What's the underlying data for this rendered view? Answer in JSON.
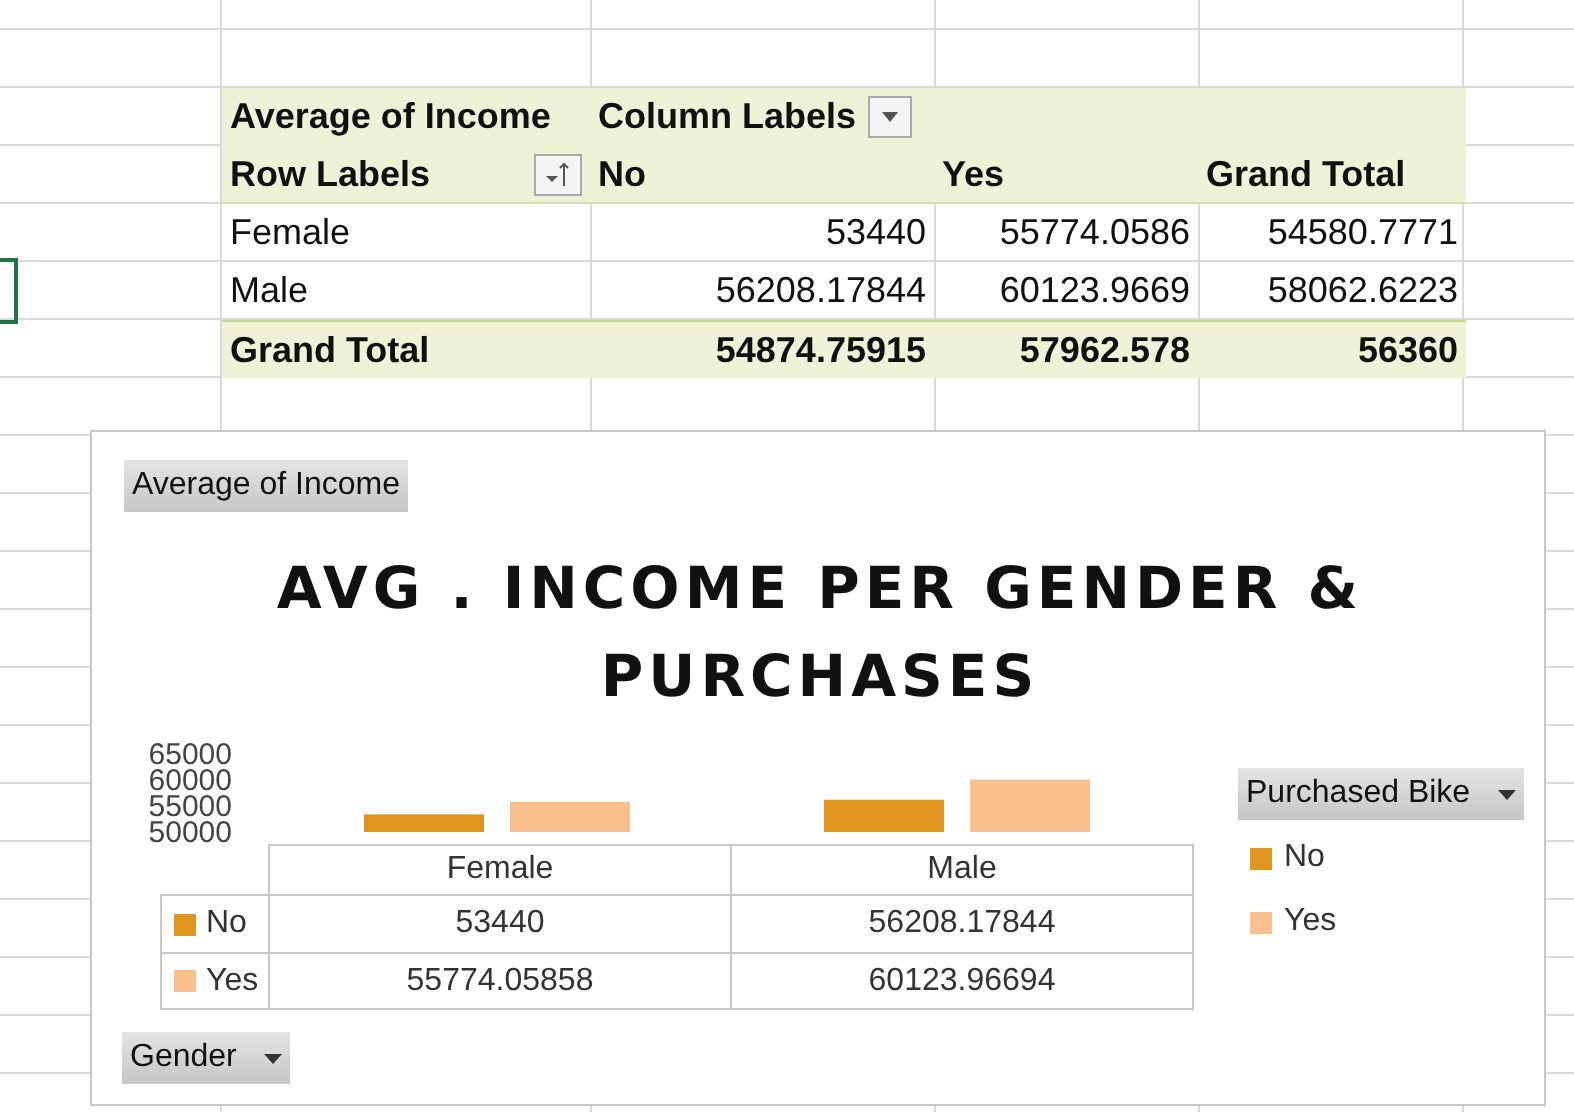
{
  "pivot": {
    "value_field": "Average of Income",
    "column_labels": "Column Labels",
    "row_labels": "Row Labels",
    "columns": [
      "No",
      "Yes",
      "Grand Total"
    ],
    "rows": [
      {
        "label": "Female",
        "values": [
          "53440",
          "55774.0586",
          "54580.7771"
        ]
      },
      {
        "label": "Male",
        "values": [
          "56208.17844",
          "60123.9669",
          "58062.6223"
        ]
      }
    ],
    "grand_total": {
      "label": "Grand Total",
      "values": [
        "54874.75915",
        "57962.578",
        "56360"
      ]
    }
  },
  "chart": {
    "field_button": "Average of Income",
    "chart_data": {
      "type": "bar",
      "title": "AVG . INCOME PER GENDER & PURCHASES",
      "legend": "right",
      "categories": [
        "Female",
        "Male"
      ],
      "ylim": [
        50000,
        65000
      ],
      "yticks": [
        50000,
        55000,
        60000,
        65000
      ],
      "series": [
        {
          "name": "No",
          "color": "#e0961e",
          "values": [
            53400,
            56200
          ]
        },
        {
          "name": "Yes",
          "color": "#f8c08f",
          "values": [
            55800,
            60100
          ]
        }
      ]
    },
    "data_table": {
      "rows": [
        {
          "label": "No",
          "color": "#e0961e",
          "values": [
            "53440",
            "56208.17844"
          ]
        },
        {
          "label": "Yes",
          "color": "#f8c08f",
          "values": [
            "55774.05858",
            "60123.96694"
          ]
        }
      ]
    },
    "axis_button": "Gender",
    "legend": {
      "title": "Purchased Bike"
    }
  }
}
